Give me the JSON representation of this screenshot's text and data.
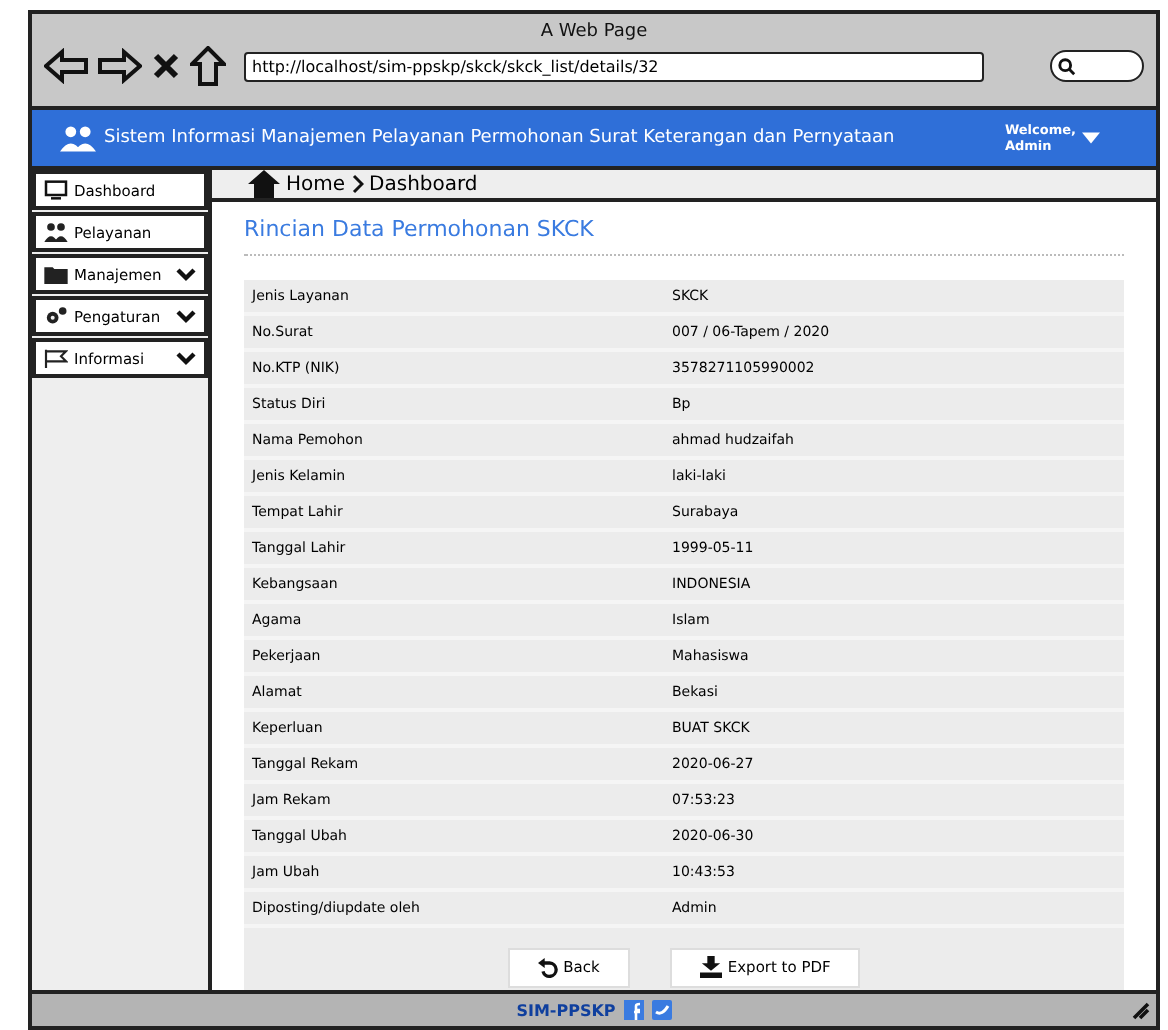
{
  "window": {
    "title": "A Web Page",
    "url": "http://localhost/sim-ppskp/skck/skck_list/details/32"
  },
  "header": {
    "title": "Sistem Informasi Manajemen Pelayanan Permohonan Surat Keterangan dan Pernyataan",
    "welcome": "Welcome,",
    "user": "Admin"
  },
  "sidebar": {
    "items": [
      {
        "label": "Dashboard",
        "kind": "link"
      },
      {
        "label": "Pelayanan",
        "kind": "link"
      },
      {
        "label": "Manajemen",
        "kind": "group"
      },
      {
        "label": "Pengaturan",
        "kind": "group"
      },
      {
        "label": "Informasi",
        "kind": "group"
      }
    ]
  },
  "breadcrumb": {
    "home": "Home",
    "current": "Dashboard"
  },
  "section_title": "Rincian Data Permohonan SKCK",
  "table": {
    "rows": [
      {
        "label": "Jenis Layanan",
        "value": "SKCK"
      },
      {
        "label": "No.Surat",
        "value": "007 / 06-Tapem / 2020"
      },
      {
        "label": "No.KTP (NIK)",
        "value": "3578271105990002"
      },
      {
        "label": "Status Diri",
        "value": "Bp"
      },
      {
        "label": "Nama Pemohon",
        "value": "ahmad hudzaifah"
      },
      {
        "label": "Jenis Kelamin",
        "value": "laki-laki"
      },
      {
        "label": "Tempat Lahir",
        "value": "Surabaya"
      },
      {
        "label": "Tanggal Lahir",
        "value": "1999-05-11"
      },
      {
        "label": "Kebangsaan",
        "value": "INDONESIA"
      },
      {
        "label": "Agama",
        "value": "Islam"
      },
      {
        "label": "Pekerjaan",
        "value": "Mahasiswa"
      },
      {
        "label": "Alamat",
        "value": "Bekasi"
      },
      {
        "label": "Keperluan",
        "value": "BUAT SKCK"
      },
      {
        "label": "Tanggal Rekam",
        "value": "2020-06-27"
      },
      {
        "label": "Jam Rekam",
        "value": "07:53:23"
      },
      {
        "label": "Tanggal Ubah",
        "value": "2020-06-30"
      },
      {
        "label": "Jam Ubah",
        "value": "10:43:53"
      },
      {
        "label": "Diposting/diupdate oleh",
        "value": "Admin"
      }
    ]
  },
  "buttons": [
    {
      "label": "Back",
      "kind": "back"
    },
    {
      "label": "Export to PDF",
      "kind": "export"
    }
  ],
  "footer": {
    "text": "SIM-PPSKP"
  }
}
